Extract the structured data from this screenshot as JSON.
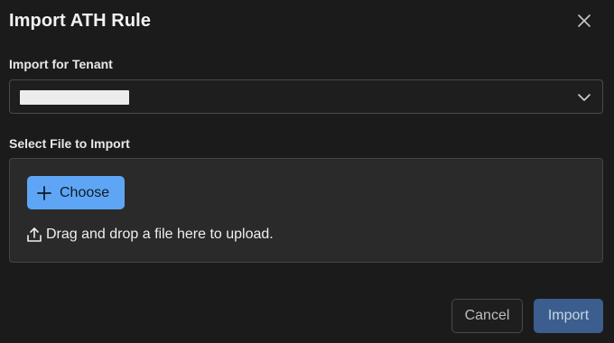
{
  "dialog": {
    "title": "Import ATH Rule",
    "close_icon": "close-icon"
  },
  "tenant": {
    "label": "Import for Tenant",
    "selected_value": "",
    "chevron_icon": "chevron-down-icon"
  },
  "file": {
    "label": "Select File to Import",
    "choose_label": "Choose",
    "choose_icon": "plus-icon",
    "drop_text": "Drag and drop a file here to upload.",
    "drop_icon": "upload-icon"
  },
  "footer": {
    "cancel_label": "Cancel",
    "import_label": "Import"
  },
  "colors": {
    "background": "#1b1b1b",
    "upload_area": "#2a2a2a",
    "choose_button": "#5ea6f5",
    "import_button_disabled": "#3b5e8e"
  }
}
